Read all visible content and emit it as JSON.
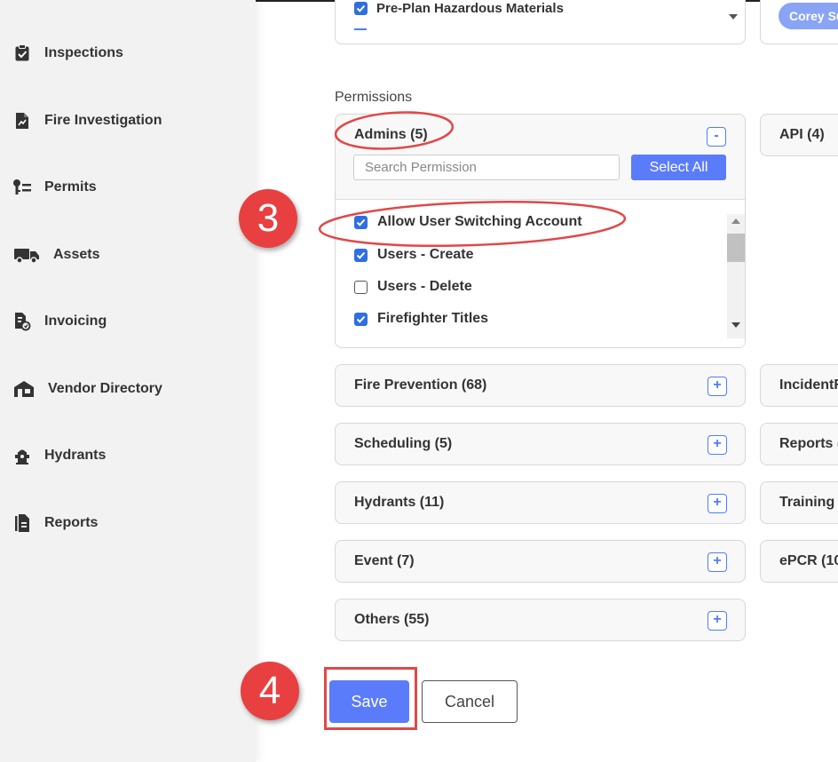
{
  "sidebar": {
    "items": [
      {
        "label": "Inspections",
        "icon": "clipboard-check-icon"
      },
      {
        "label": "Fire Investigation",
        "icon": "file-chart-icon"
      },
      {
        "label": "Permits",
        "icon": "key-list-icon"
      },
      {
        "label": "Assets",
        "icon": "truck-icon"
      },
      {
        "label": "Invoicing",
        "icon": "invoice-icon"
      },
      {
        "label": "Vendor Directory",
        "icon": "store-icon"
      },
      {
        "label": "Hydrants",
        "icon": "hydrant-icon"
      },
      {
        "label": "Reports",
        "icon": "report-file-icon"
      }
    ]
  },
  "top_box": {
    "item_label": "Pre-Plan Hazardous Materials",
    "item_checked": true
  },
  "user_chip": {
    "label": "Corey Su"
  },
  "permissions": {
    "section_label": "Permissions",
    "admins": {
      "title": "Admins (5)",
      "collapse_label": "-",
      "search_placeholder": "Search Permission",
      "select_all_label": "Select All",
      "items": [
        {
          "label": "Allow User Switching Account",
          "checked": true
        },
        {
          "label": "Users - Create",
          "checked": true
        },
        {
          "label": "Users - Delete",
          "checked": false
        },
        {
          "label": "Firefighter Titles",
          "checked": true
        }
      ]
    },
    "groups": [
      {
        "title": "Fire Prevention (68)",
        "expand_label": "+"
      },
      {
        "title": "Scheduling (5)",
        "expand_label": "+"
      },
      {
        "title": "Hydrants (11)",
        "expand_label": "+"
      },
      {
        "title": "Event (7)",
        "expand_label": "+"
      },
      {
        "title": "Others (55)",
        "expand_label": "+"
      }
    ],
    "right_groups": [
      {
        "title": "API (4)"
      },
      {
        "title": "IncidentR"
      },
      {
        "title": "Reports ("
      },
      {
        "title": "Training ("
      },
      {
        "title": "ePCR (10"
      }
    ]
  },
  "actions": {
    "save_label": "Save",
    "cancel_label": "Cancel"
  },
  "annotations": {
    "step3": "3",
    "step4": "4"
  },
  "colors": {
    "accent": "#5b7cfa",
    "checkbox": "#2f6fe0",
    "annotation": "#e84040"
  }
}
